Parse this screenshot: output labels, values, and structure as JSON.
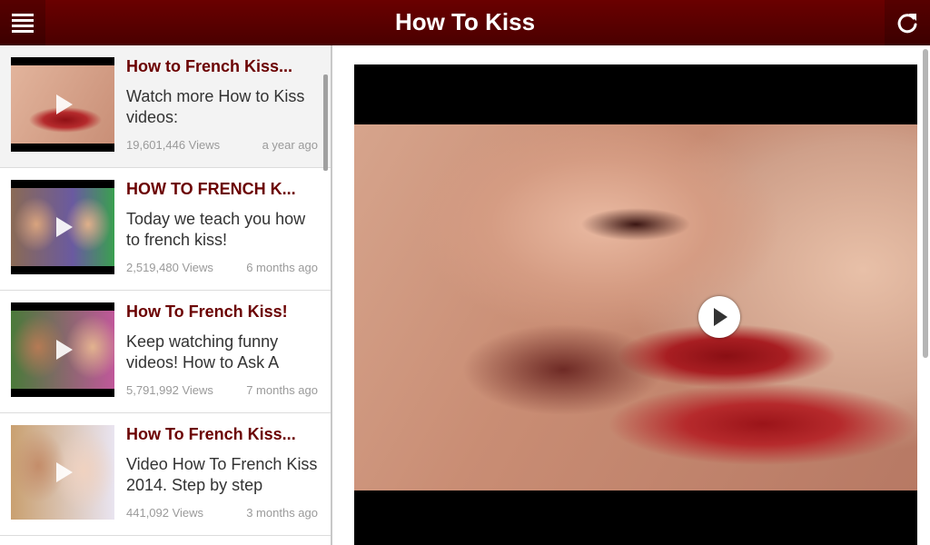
{
  "app": {
    "title": "How To Kiss",
    "icons": {
      "menu": "menu-icon",
      "refresh": "refresh-icon",
      "play": "play-icon"
    }
  },
  "colors": {
    "accent": "#5c0000",
    "title_text": "#6b0000",
    "meta_text": "#9a9a9a"
  },
  "videos": [
    {
      "title": "How to French Kiss...",
      "description": "Watch more How to Kiss videos:",
      "views": "19,601,446 Views",
      "age": "a year ago"
    },
    {
      "title": "HOW TO FRENCH K...",
      "description": "Today we teach you how to french kiss!",
      "views": "2,519,480 Views",
      "age": "6 months ago"
    },
    {
      "title": "How To French Kiss!",
      "description": "Keep watching funny videos! How to Ask A",
      "views": "5,791,992 Views",
      "age": "7 months ago"
    },
    {
      "title": "How To French Kiss...",
      "description": "Video How To French Kiss 2014. Step by step",
      "views": "441,092 Views",
      "age": "3 months ago"
    }
  ]
}
